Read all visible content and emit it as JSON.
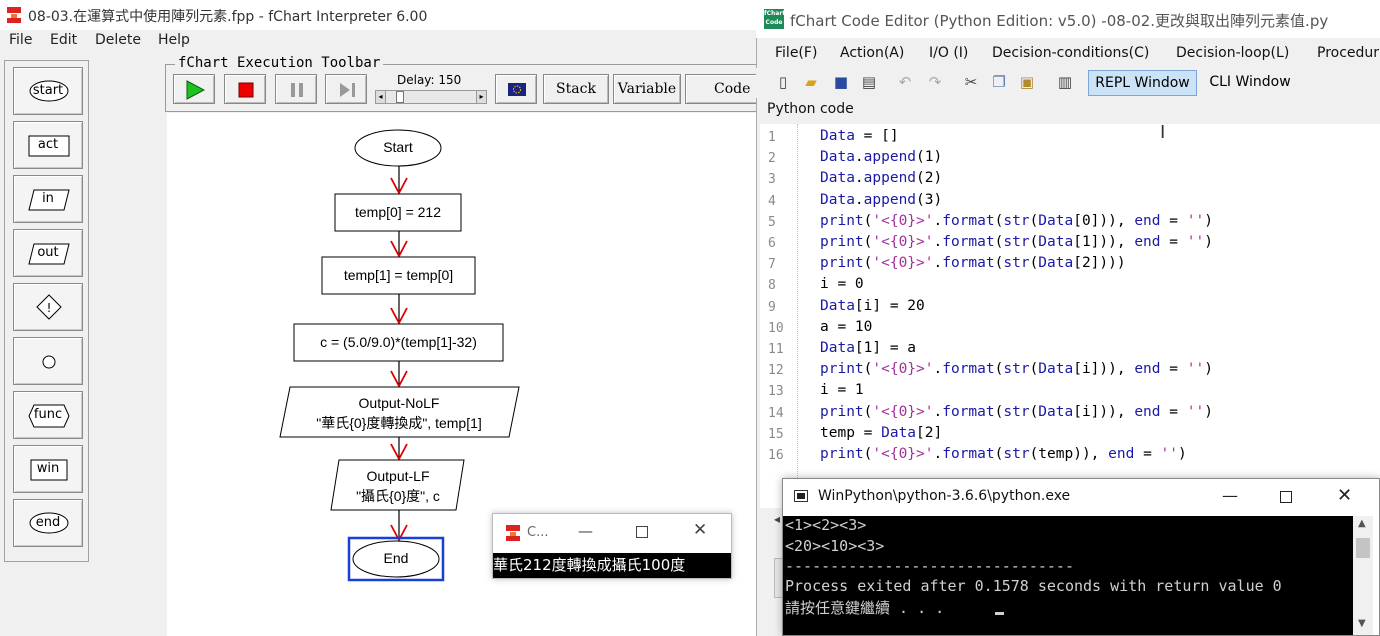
{
  "flowchart_window": {
    "title": "08-03.在運算式中使用陣列元素.fpp - fChart Interpreter 6.00",
    "menu": [
      "File",
      "Edit",
      "Delete",
      "Help"
    ],
    "palette": [
      "start",
      "act",
      "in",
      "out",
      "",
      "",
      "func",
      "win",
      "end"
    ],
    "toolbar": {
      "legend": "fChart Execution Toolbar",
      "delay_label": "Delay: 150",
      "stack": "Stack",
      "variable": "Variable",
      "code_editor": "Code E"
    },
    "nodes": {
      "start": "Start",
      "n1": "temp[0] = 212",
      "n2": "temp[1] = temp[0]",
      "n3": "c = (5.0/9.0)*(temp[1]-32)",
      "n4a": "Output-NoLF",
      "n4b": "\"華氏{0}度轉換成\", temp[1]",
      "n5a": "Output-LF",
      "n5b": "\"攝氏{0}度\", c",
      "end": "End"
    },
    "mini_console": {
      "title": "C...",
      "output": "華氏212度轉換成攝氏100度"
    }
  },
  "editor_window": {
    "title": "fChart Code Editor (Python Edition:  v5.0) -08-02.更改與取出陣列元素值.py",
    "menu": [
      "File(F)",
      "Action(A)",
      "I/O (I)",
      "Decision-conditions(C)",
      "Decision-loop(L)",
      "Procedur"
    ],
    "repl_button": "REPL Window",
    "cli_button": "CLI Window",
    "section_label": "Python code",
    "code_lines": [
      "Data = []",
      "Data.append(1)",
      "Data.append(2)",
      "Data.append(3)",
      "print('<{0}>'.format(str(Data[0])), end = '')",
      "print('<{0}>'.format(str(Data[1])), end = '')",
      "print('<{0}>'.format(str(Data[2])))",
      "i = 0",
      "Data[i] = 20",
      "a = 10",
      "Data[1] = a",
      "print('<{0}>'.format(str(Data[i])), end = '')",
      "i = 1",
      "print('<{0}>'.format(str(Data[i])), end = '')",
      "temp = Data[2]",
      "print('<{0}>'.format(str(temp)), end = '')"
    ]
  },
  "python_console": {
    "title": "WinPython\\python-3.6.6\\python.exe",
    "lines": [
      "<1><2><3>",
      "<20><10><3>",
      "--------------------------------",
      "Process exited after 0.1578 seconds with return value 0",
      "請按任意鍵繼續 . . . "
    ]
  },
  "colors": {
    "keyword": "#1a1aa6",
    "string": "#a0309a",
    "arrow": "#e00000",
    "selection": "#1a3fd6"
  }
}
